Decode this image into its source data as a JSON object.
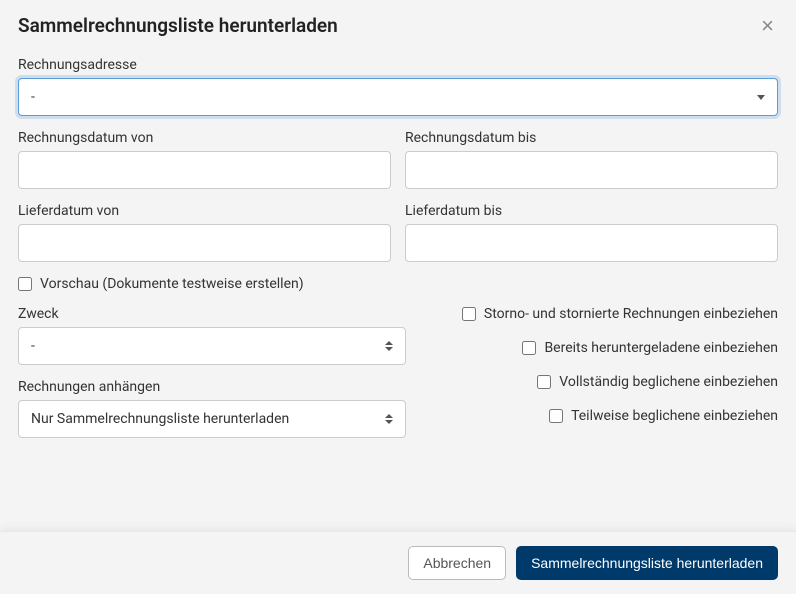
{
  "header": {
    "title": "Sammelrechnungsliste herunterladen",
    "close": "×"
  },
  "form": {
    "billingAddress": {
      "label": "Rechnungsadresse",
      "value": "-"
    },
    "invoiceDateFrom": {
      "label": "Rechnungsdatum von",
      "value": ""
    },
    "invoiceDateTo": {
      "label": "Rechnungsdatum bis",
      "value": ""
    },
    "deliveryDateFrom": {
      "label": "Lieferdatum von",
      "value": ""
    },
    "deliveryDateTo": {
      "label": "Lieferdatum bis",
      "value": ""
    },
    "previewLabel": "Vorschau (Dokumente testweise erstellen)",
    "purpose": {
      "label": "Zweck",
      "value": "-"
    },
    "attachInvoices": {
      "label": "Rechnungen anhängen",
      "value": "Nur Sammelrechnungsliste herunterladen"
    },
    "opts": {
      "includeCancelled": "Storno- und stornierte Rechnungen einbeziehen",
      "includeDownloaded": "Bereits heruntergeladene einbeziehen",
      "includeFullyPaid": "Vollständig beglichene einbeziehen",
      "includePartiallyPaid": "Teilweise beglichene einbeziehen"
    }
  },
  "footer": {
    "cancel": "Abbrechen",
    "submit": "Sammelrechnungsliste herunterladen"
  }
}
